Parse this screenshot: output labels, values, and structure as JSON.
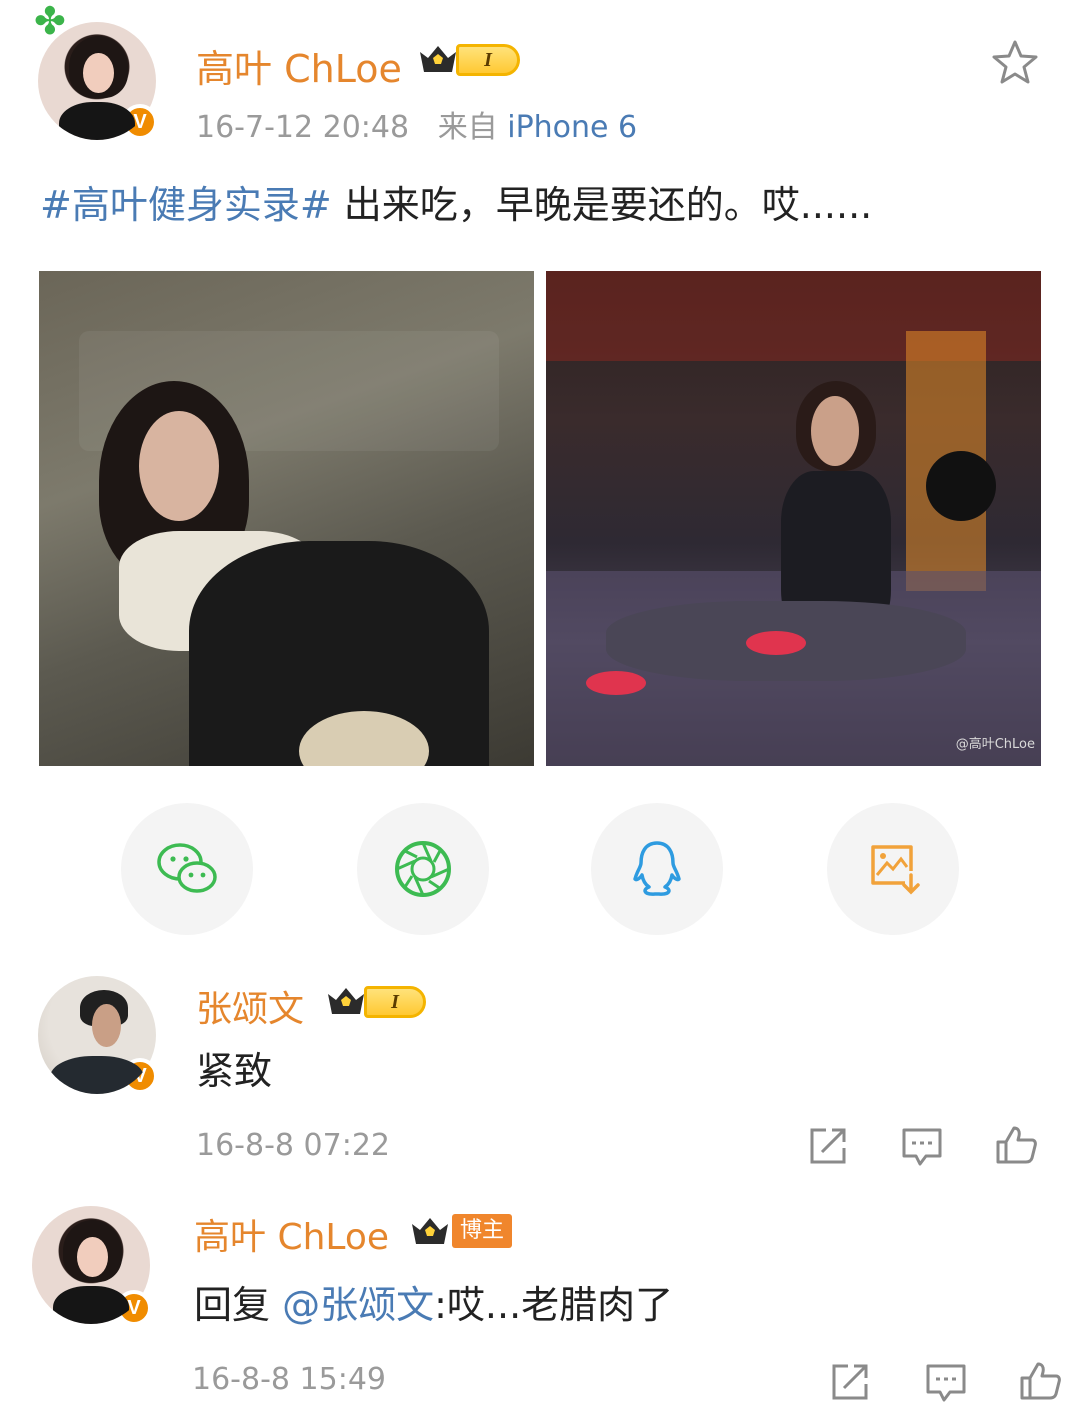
{
  "post": {
    "author": "高叶 ChLoe",
    "level": "I",
    "time": "16-7-12 20:48",
    "source_prefix": "来自",
    "source_device": "iPhone 6",
    "hashtag": "#高叶健身实录#",
    "text": " 出来吃，早晚是要还的。哎......",
    "watermark": "@高叶ChLoe",
    "verified": "V"
  },
  "share": {
    "items": [
      "wechat-icon",
      "moments-icon",
      "qq-icon",
      "save-image-icon"
    ],
    "colors": {
      "wechat": "#3dbb52",
      "moments": "#3dbb52",
      "qq": "#2e9be0",
      "save": "#f1a23a"
    }
  },
  "comments": [
    {
      "author": "张颂文",
      "level": "I",
      "text": "紧致",
      "time": "16-8-8 07:22",
      "verified": "V"
    },
    {
      "author": "高叶 ChLoe",
      "badge": "博主",
      "reply_prefix": "回复",
      "mention": "@张颂文",
      "text": ":哎...老腊肉了",
      "time": "16-8-8 15:49",
      "verified": "V"
    }
  ],
  "colors": {
    "name": "#e5862d",
    "link": "#4a7bb4",
    "meta": "#9a9a9a",
    "icon": "#8a8a8a"
  }
}
